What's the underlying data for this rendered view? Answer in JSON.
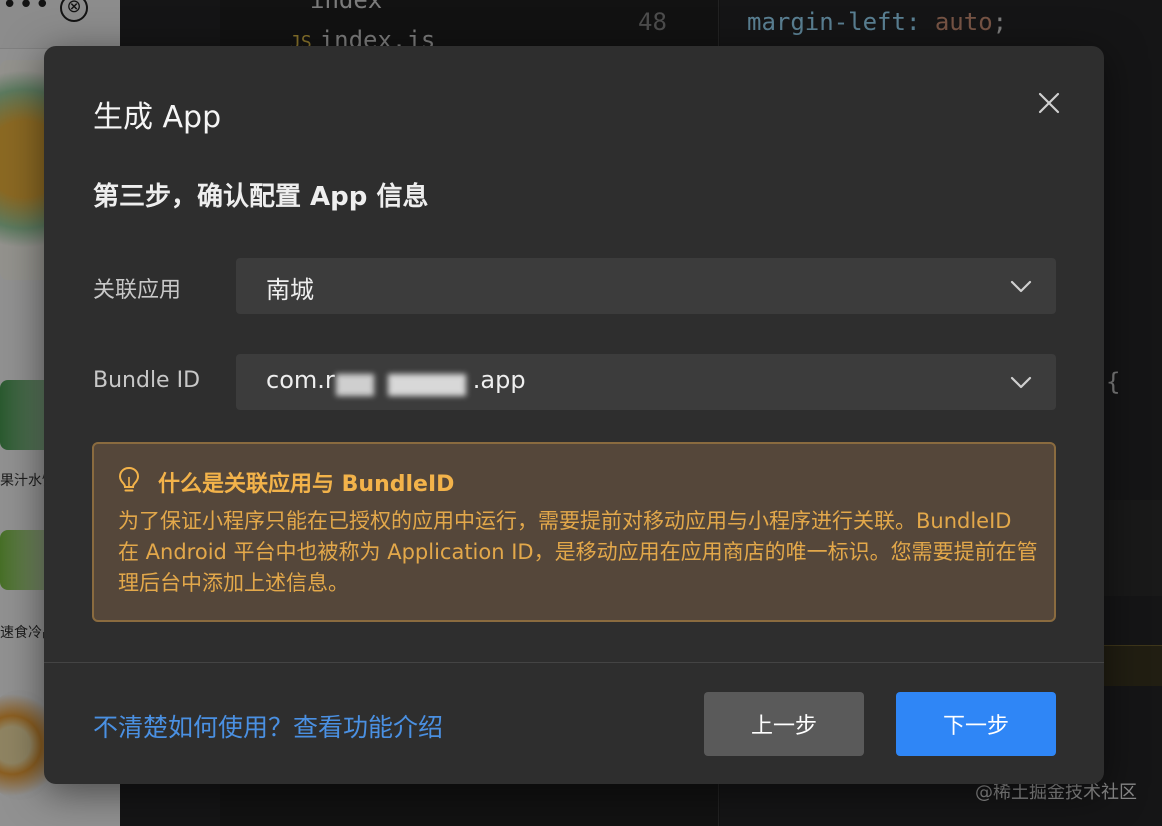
{
  "background": {
    "code_index": "index",
    "code_indexjs_badge": "JS",
    "code_indexjs_name": "index.js",
    "code_linenum": "48",
    "code_css_prop": "margin-left: ",
    "code_css_value": "auto",
    "code_css_end": ";",
    "code_brace": "{",
    "left_label_1": "果汁水饮料",
    "left_label_2": "速食冷品",
    "left_close_glyph": "⊗",
    "left_dots": "•••"
  },
  "modal": {
    "title": "生成 App",
    "close_icon": "close-icon",
    "step_title": "第三步，确认配置 App 信息",
    "fields": {
      "app_label": "关联应用",
      "app_value": "南城",
      "bundle_label": "Bundle ID",
      "bundle_prefix": "com.r",
      "bundle_suffix": ".app"
    },
    "tip": {
      "icon": "lightbulb-icon",
      "title": "什么是关联应用与 BundleID",
      "body": "为了保证小程序只能在已授权的应用中运行，需要提前对移动应用与小程序进行关联。BundleID 在 Android 平台中也被称为 Application ID，是移动应用在应用商店的唯一标识。您需要提前在管理后台中添加上述信息。"
    },
    "footer": {
      "help_link": "不清楚如何使用？查看功能介绍",
      "prev_label": "上一步",
      "next_label": "下一步"
    }
  },
  "watermark": "@稀土掘金技术社区",
  "colors": {
    "modal_bg": "#2e2e2e",
    "primary": "#2f86f6",
    "link": "#4a90e2",
    "tip_bg": "#55473a",
    "tip_text": "#e3a84a"
  }
}
